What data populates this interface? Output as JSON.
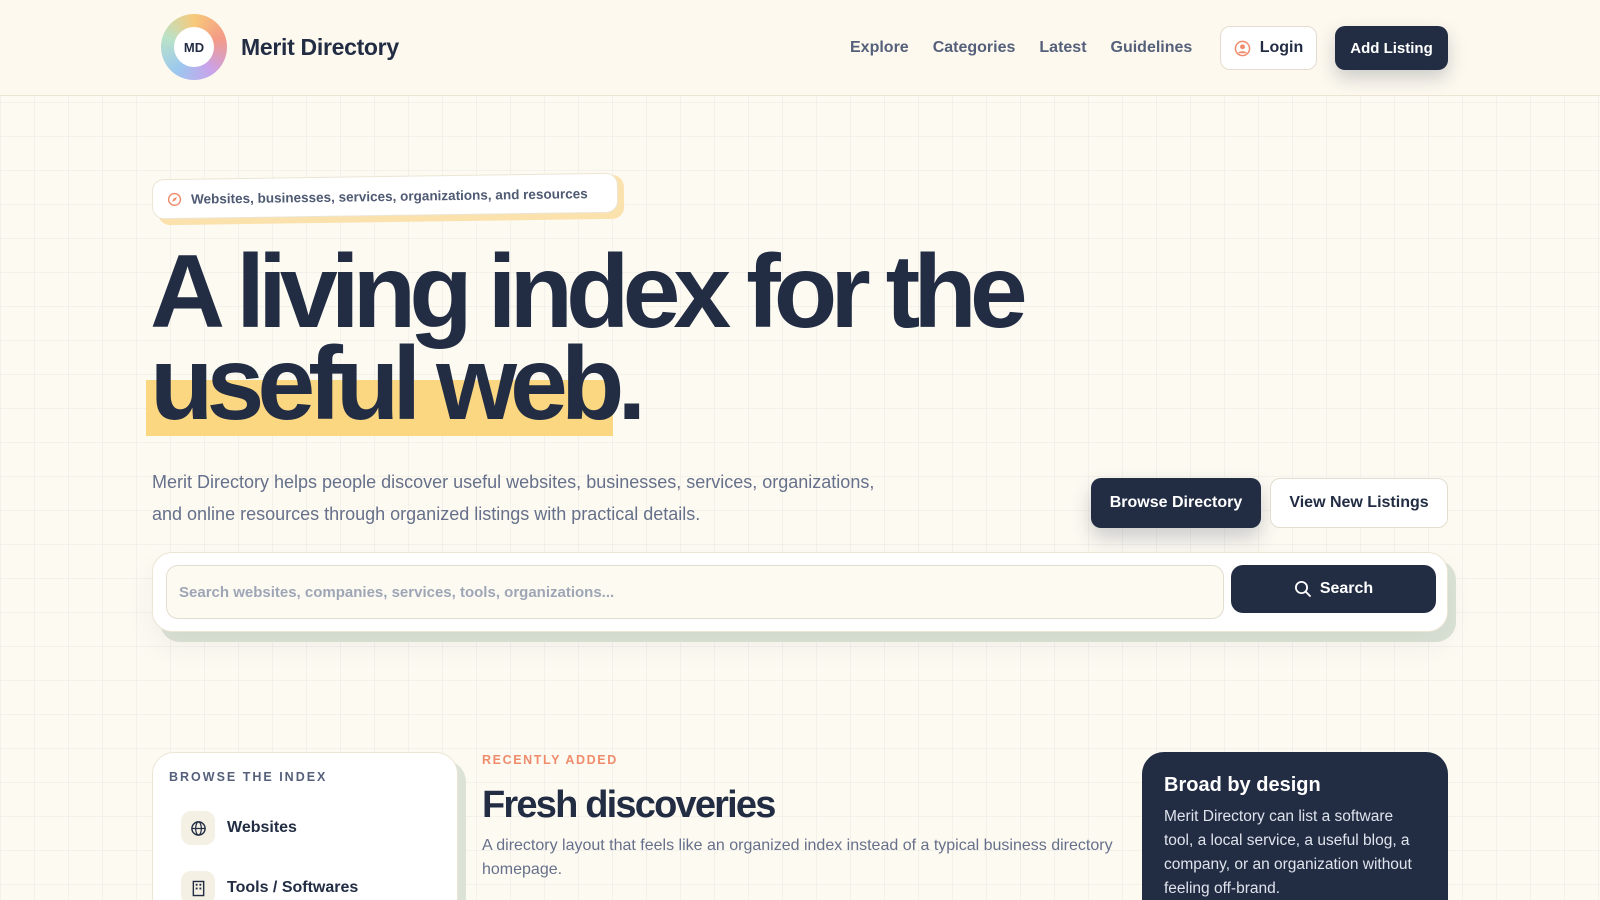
{
  "brand": {
    "logo_text": "MD",
    "name": "Merit Directory"
  },
  "nav": {
    "items": [
      {
        "label": "Explore"
      },
      {
        "label": "Categories"
      },
      {
        "label": "Latest"
      },
      {
        "label": "Guidelines"
      }
    ],
    "login_label": "Login",
    "add_listing_label": "Add Listing"
  },
  "hero": {
    "badge": "Websites, businesses, services, organizations, and resources",
    "headline_line1": "A living index for the",
    "headline_highlight": "useful web",
    "headline_end": ".",
    "description": "Merit Directory helps people discover useful websites, businesses, services, organizations, and online resources through organized listings with practical details.",
    "browse_label": "Browse Directory",
    "view_new_label": "View New Listings"
  },
  "search": {
    "placeholder": "Search websites, companies, services, tools, organizations...",
    "value": "",
    "button_label": "Search"
  },
  "sidebar": {
    "title": "BROWSE THE INDEX",
    "items": [
      {
        "label": "Websites",
        "icon": "globe-icon"
      },
      {
        "label": "Tools / Softwares",
        "icon": "building-icon"
      }
    ]
  },
  "recent": {
    "kicker": "RECENTLY ADDED",
    "title": "Fresh discoveries",
    "description": "A directory layout that feels like an organized index instead of a typical business directory homepage."
  },
  "info_card": {
    "title": "Broad by design",
    "text": "Merit Directory can list a software tool, a local service, a useful blog, a company, or an organization without feeling off-brand."
  },
  "colors": {
    "navy": "#222d44",
    "highlight": "#fbd782",
    "accent": "#f08c6c",
    "background": "#fdfaf2"
  }
}
